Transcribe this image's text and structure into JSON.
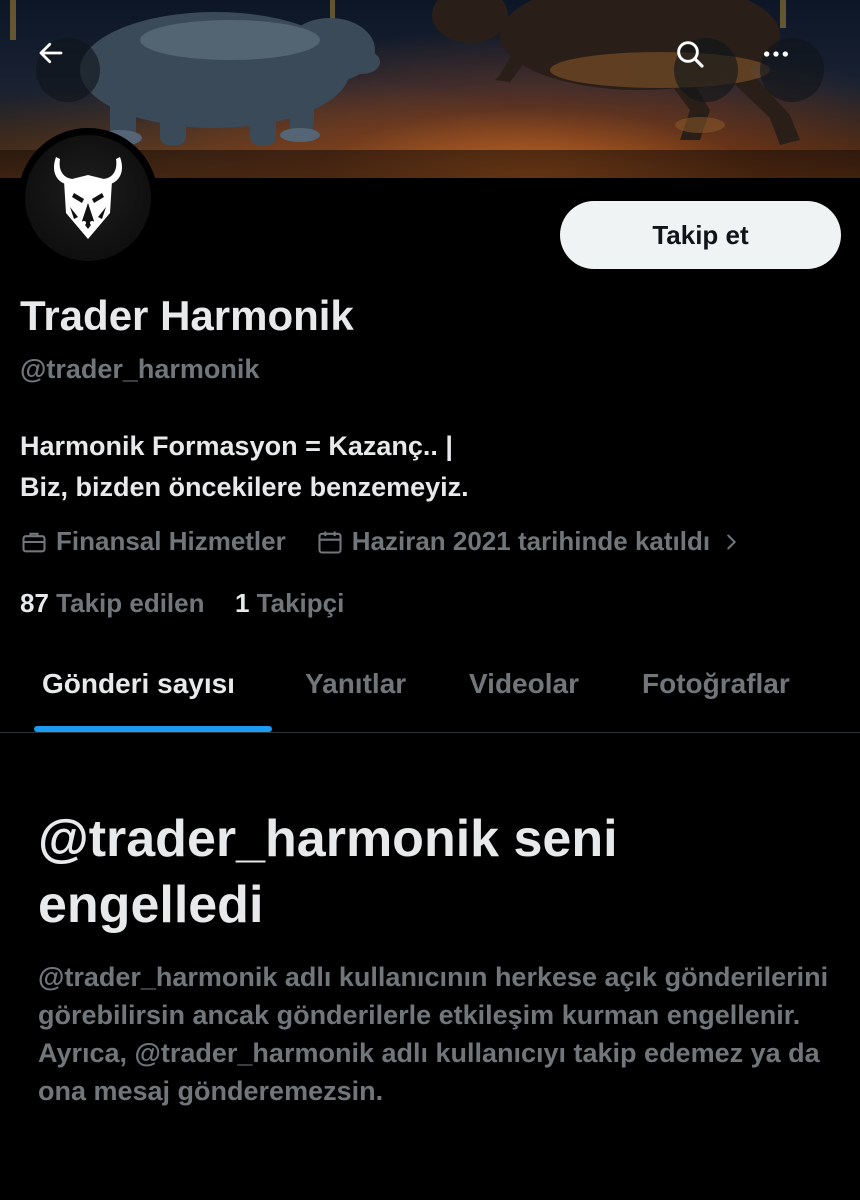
{
  "profile": {
    "name": "Trader Harmonik",
    "handle": "@trader_harmonik",
    "bio_line1": "Harmonik Formasyon = Kazanç.. |",
    "bio_line2": "Biz, bizden öncekilere benzemeyiz.",
    "category": "Finansal Hizmetler",
    "joined": "Haziran 2021 tarihinde katıldı",
    "following_count": "87",
    "following_label": "Takip edilen",
    "followers_count": "1",
    "followers_label": "Takipçi"
  },
  "header": {
    "follow_label": "Takip et",
    "icons": [
      "back-arrow-icon",
      "search-icon",
      "more-icon"
    ]
  },
  "tabs": [
    {
      "label": "Gönderi sayısı",
      "active": true
    },
    {
      "label": "Yanıtlar",
      "active": false
    },
    {
      "label": "Videolar",
      "active": false
    },
    {
      "label": "Fotoğraflar",
      "active": false
    }
  ],
  "blocked": {
    "title": "@trader_harmonik seni engelledi",
    "description": "@trader_harmonik adlı kullanıcının herkese açık gönderilerini görebilirsin ancak gönderilerle etkileşim kurman engellenir. Ayrıca, @trader_harmonik adlı kullanıcıyı takip edemez ya da ona mesaj gönderemezsin."
  },
  "colors": {
    "accent": "#1d9bf0",
    "background": "#000000",
    "text_primary": "#e7e9ea",
    "text_secondary": "#71767b",
    "follow_button_bg": "#eff3f4"
  }
}
